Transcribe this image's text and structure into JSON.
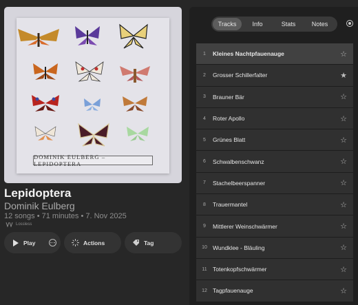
{
  "album": {
    "title": "Lepidoptera",
    "artist": "Dominik Eulberg",
    "meta": "12 songs • 71 minutes • 7. Nov 2025",
    "badge": "Lossless",
    "cover_text": "DOMINIK EULBERG – LEPIDOPTERA"
  },
  "actions": {
    "play": "Play",
    "actions": "Actions",
    "tag": "Tag"
  },
  "tabs": [
    {
      "label": "Tracks",
      "active": true
    },
    {
      "label": "Info",
      "active": false
    },
    {
      "label": "Stats",
      "active": false
    },
    {
      "label": "Notes",
      "active": false
    }
  ],
  "tracks": [
    {
      "num": "1",
      "title": "Kleines Nachtpfauenauge",
      "starred": false,
      "selected": true
    },
    {
      "num": "2",
      "title": "Grosser Schillerfalter",
      "starred": true,
      "selected": false
    },
    {
      "num": "3",
      "title": "Brauner Bär",
      "starred": false,
      "selected": false
    },
    {
      "num": "4",
      "title": "Roter Apollo",
      "starred": false,
      "selected": false
    },
    {
      "num": "5",
      "title": "Grünes Blatt",
      "starred": false,
      "selected": false
    },
    {
      "num": "6",
      "title": "Schwalbenschwanz",
      "starred": false,
      "selected": false
    },
    {
      "num": "7",
      "title": "Stachelbeerspanner",
      "starred": false,
      "selected": false
    },
    {
      "num": "8",
      "title": "Trauermantel",
      "starred": false,
      "selected": false
    },
    {
      "num": "9",
      "title": "Mittlerer Weinschwärmer",
      "starred": false,
      "selected": false
    },
    {
      "num": "10",
      "title": "Wundklee - Bläuling",
      "starred": false,
      "selected": false
    },
    {
      "num": "11",
      "title": "Totenkopfschwärmer",
      "starred": false,
      "selected": false
    },
    {
      "num": "12",
      "title": "Tagpfauenauge",
      "starred": false,
      "selected": false
    }
  ],
  "colors": {
    "background": "#272727",
    "panel": "#1f1f1f",
    "row": "#303030",
    "row_selected": "#414141"
  },
  "icons": {
    "play": "play-icon",
    "more": "ellipsis-circle-icon",
    "actions": "sparkle-icon",
    "tag": "tag-icon",
    "star": "star-icon",
    "settings": "settings-circle-icon"
  }
}
